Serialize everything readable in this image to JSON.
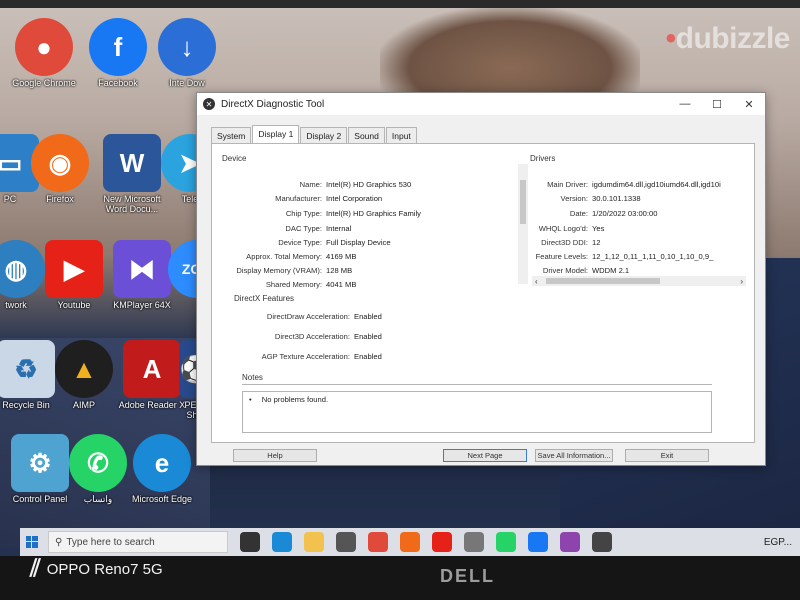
{
  "watermark": {
    "text": "dubizzle"
  },
  "desktop_icons": [
    {
      "label": "Google Chrome",
      "icon": "chrome-icon",
      "color": "#e04a3a"
    },
    {
      "label": "Facebook",
      "icon": "facebook-icon",
      "color": "#1877f2"
    },
    {
      "label": "Inte Dow",
      "icon": "internet-download-icon",
      "color": "#2b6fd6"
    },
    {
      "label": "PC",
      "icon": "pc-icon",
      "color": "#2d80c7"
    },
    {
      "label": "Firefox",
      "icon": "firefox-icon",
      "color": "#f06a1a"
    },
    {
      "label": "New Microsoft Word Docu...",
      "icon": "word-document-icon",
      "color": "#2b579a"
    },
    {
      "label": "Tele",
      "icon": "telegram-icon",
      "color": "#2aa3df"
    },
    {
      "label": "twork",
      "icon": "network-icon",
      "color": "#2d7fc0"
    },
    {
      "label": "Youtube",
      "icon": "youtube-icon",
      "color": "#e62117"
    },
    {
      "label": "KMPlayer 64X",
      "icon": "kmplayer-icon",
      "color": "#6b4fd6"
    },
    {
      "label": "ZOO",
      "icon": "zoom-icon",
      "color": "#2d8cff"
    },
    {
      "label": "Recycle Bin",
      "icon": "recycle-bin-icon",
      "color": "#c9d7e6"
    },
    {
      "label": "AIMP",
      "icon": "aimp-icon",
      "color": "#f2b01e"
    },
    {
      "label": "Adobe Reader X",
      "icon": "adobe-reader-icon",
      "color": "#c21b1b"
    },
    {
      "label": "PES2 Shor",
      "icon": "pes-game-icon",
      "color": "#284a8c"
    },
    {
      "label": "Control Panel",
      "icon": "control-panel-icon",
      "color": "#4fa3d1"
    },
    {
      "label": "واتساب",
      "icon": "whatsapp-icon",
      "color": "#25d366"
    },
    {
      "label": "Microsoft Edge",
      "icon": "edge-icon",
      "color": "#1b8ad6"
    }
  ],
  "dxdiag": {
    "title": "DirectX Diagnostic Tool",
    "controls": {
      "minimize": "—",
      "maximize": "☐",
      "close": "✕"
    },
    "tabs": [
      "System",
      "Display 1",
      "Display 2",
      "Sound",
      "Input"
    ],
    "active_tab": "Display 1",
    "device": {
      "heading": "Device",
      "rows": [
        {
          "k": "Name:",
          "v": "Intel(R) HD Graphics 530"
        },
        {
          "k": "Manufacturer:",
          "v": "Intel Corporation"
        },
        {
          "k": "Chip Type:",
          "v": "Intel(R) HD Graphics Family"
        },
        {
          "k": "DAC Type:",
          "v": "Internal"
        },
        {
          "k": "Device Type:",
          "v": "Full Display Device"
        },
        {
          "k": "Approx. Total Memory:",
          "v": "4169 MB"
        },
        {
          "k": "Display Memory (VRAM):",
          "v": "128 MB"
        },
        {
          "k": "Shared Memory:",
          "v": "4041 MB"
        }
      ]
    },
    "drivers": {
      "heading": "Drivers",
      "rows": [
        {
          "k": "Main Driver:",
          "v": "igdumdim64.dll,igd10iumd64.dll,igd10i"
        },
        {
          "k": "Version:",
          "v": "30.0.101.1338"
        },
        {
          "k": "Date:",
          "v": "1/20/2022 03:00:00"
        },
        {
          "k": "WHQL Logo'd:",
          "v": "Yes"
        },
        {
          "k": "Direct3D DDI:",
          "v": "12"
        },
        {
          "k": "Feature Levels:",
          "v": "12_1,12_0,11_1,11_0,10_1,10_0,9_"
        },
        {
          "k": "Driver Model:",
          "v": "WDDM 2.1"
        }
      ]
    },
    "features": {
      "heading": "DirectX Features",
      "rows": [
        {
          "k": "DirectDraw Acceleration:",
          "v": "Enabled"
        },
        {
          "k": "Direct3D Acceleration:",
          "v": "Enabled"
        },
        {
          "k": "AGP Texture Acceleration:",
          "v": "Enabled"
        }
      ]
    },
    "notes": {
      "heading": "Notes",
      "items": [
        "No problems found."
      ]
    },
    "buttons": {
      "help": "Help",
      "next_page": "Next Page",
      "save_all": "Save All Information...",
      "exit": "Exit"
    }
  },
  "taskbar": {
    "search_placeholder": "Type here to search",
    "tray_text": "EGP..."
  },
  "device_watermark": {
    "brand": "OPPO Reno7 5G",
    "laptop_brand": "DELL"
  }
}
